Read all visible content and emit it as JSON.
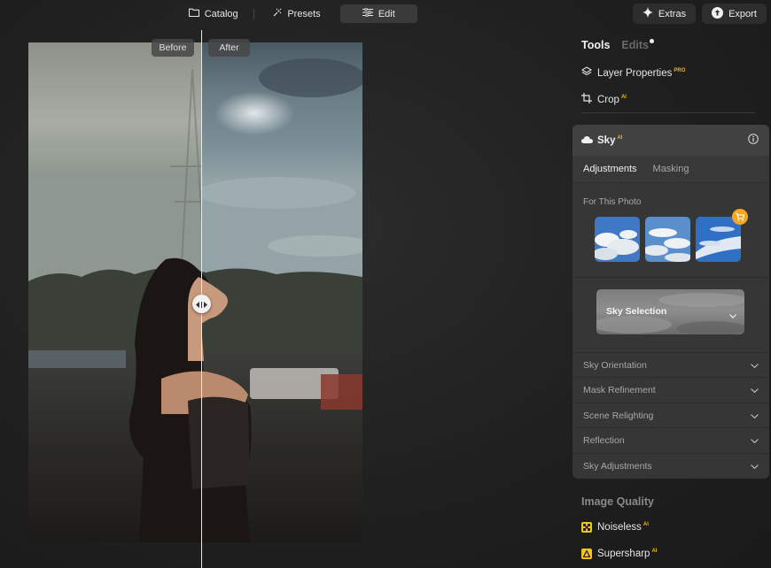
{
  "topbar": {
    "tabs": [
      {
        "label": "Catalog",
        "icon": "folder-icon"
      },
      {
        "label": "Presets",
        "icon": "presets-icon"
      },
      {
        "label": "Edit",
        "icon": "sliders-icon",
        "active": true
      }
    ],
    "extras_label": "Extras",
    "export_label": "Export"
  },
  "compare": {
    "before_label": "Before",
    "after_label": "After"
  },
  "panel": {
    "tabs": [
      {
        "label": "Tools",
        "active": true
      },
      {
        "label": "Edits",
        "active": false,
        "has_dot": true
      }
    ],
    "tools": [
      {
        "label": "Layer Properties",
        "badge": "PRO",
        "icon": "layers-icon"
      },
      {
        "label": "Crop",
        "badge": "AI",
        "icon": "crop-icon"
      }
    ],
    "sky": {
      "title": "Sky",
      "badge": "AI",
      "subtabs": [
        "Adjustments",
        "Masking"
      ],
      "active_subtab": "Adjustments",
      "for_photo_label": "For This Photo",
      "selection_label": "Sky Selection",
      "sections": [
        "Sky Orientation",
        "Mask Refinement",
        "Scene Relighting",
        "Reflection",
        "Sky Adjustments"
      ]
    },
    "image_quality": {
      "title": "Image Quality",
      "items": [
        {
          "label": "Noiseless",
          "badge": "AI",
          "icon": "noiseless-icon"
        },
        {
          "label": "Supersharp",
          "badge": "AI",
          "icon": "supersharp-icon"
        }
      ]
    }
  },
  "colors": {
    "accent": "#f5b316",
    "cart": "#f5a623"
  }
}
